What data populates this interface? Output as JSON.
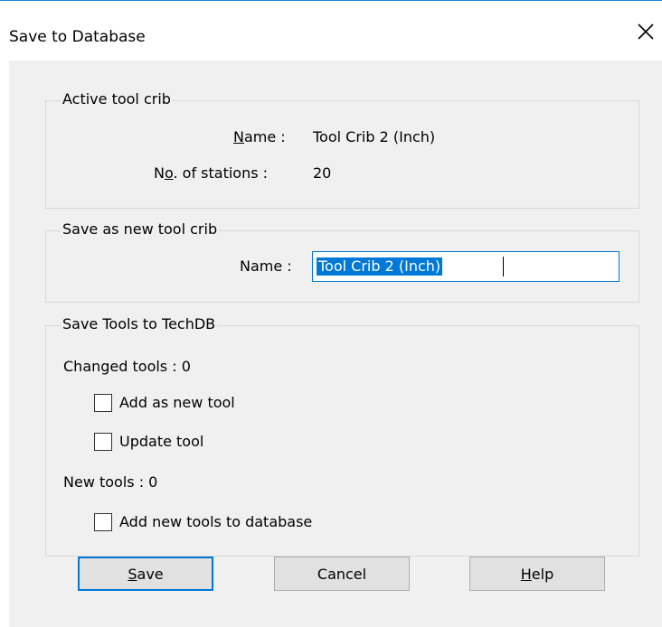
{
  "dialog": {
    "title": "Save to Database",
    "close_label": "Close"
  },
  "active_crib": {
    "legend": "Active tool crib",
    "name_label_access": "N",
    "name_label_rest": "ame : ",
    "name_value": "Tool Crib 2 (Inch)",
    "stations_label_pre": "N",
    "stations_label_access": "o",
    "stations_label_rest": ". of stations : ",
    "stations_value": "20"
  },
  "new_crib": {
    "legend": "Save as new tool crib",
    "name_label": "Name :",
    "name_value": "Tool Crib 2 (Inch)"
  },
  "save_tools": {
    "legend": "Save Tools to TechDB",
    "changed_label": "Changed tools : 0",
    "add_new_tool": "Add as new tool",
    "update_tool": "Update tool",
    "new_tools_label": "New tools : 0",
    "add_to_database": "Add new tools to database"
  },
  "buttons": {
    "save_access": "S",
    "save_rest": "ave",
    "cancel": "Cancel",
    "help_access": "H",
    "help_rest": "elp"
  },
  "colors": {
    "accent": "#0078d7",
    "title_border": "#1883d7",
    "dialog_bg": "#f0f0f0",
    "button_bg": "#e1e1e1"
  },
  "icons": [
    "close-icon"
  ]
}
